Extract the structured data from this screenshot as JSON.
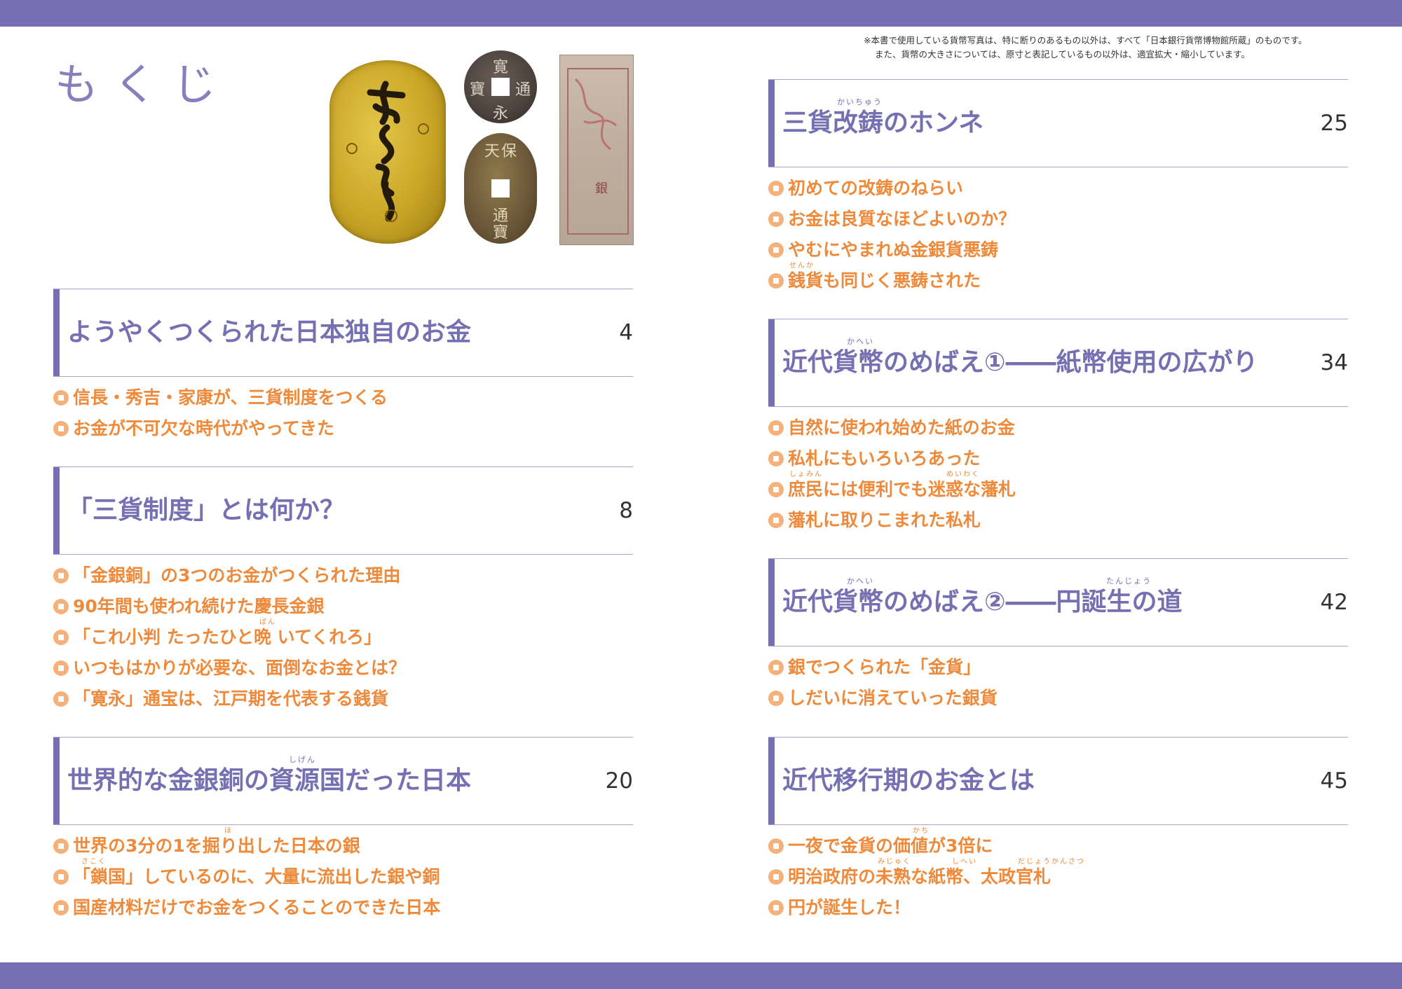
{
  "page_title": "もくじ",
  "note": {
    "line1": "※本書で使用している貨幣写真は、特に断りのあるもの以外は、すべて「日本銀行貨幣博物館所蔵」のものです。",
    "line2": "また、貨幣の大きさについては、原寸と表記しているもの以外は、適宜拡大・縮小しています。"
  },
  "images": {
    "coin1": {
      "icon": "koban-coin-image"
    },
    "coin2": {
      "icon": "kanei-tsuho-coin-image",
      "chars": [
        "寛",
        "通",
        "永",
        "寶"
      ]
    },
    "coin3": {
      "icon": "tenpo-tsuho-coin-image",
      "chars": [
        "天",
        "保",
        "通",
        "寶"
      ]
    },
    "note": {
      "icon": "hansatsu-paper-note-image",
      "mark": "銀"
    }
  },
  "colors": {
    "band": "#7670b3",
    "heading": "#7670b3",
    "item": "#ee8a3b",
    "bullet": "#f6b07a"
  },
  "sections": [
    {
      "title": "ようやくつくられた日本独自のお金",
      "page": "4",
      "items": [
        "信長・秀吉・家康が、三貨制度をつくる",
        "お金が不可欠な時代がやってきた"
      ]
    },
    {
      "title": "「三貨制度」とは何か？",
      "page": "8",
      "items": [
        "「金銀銅」の3つのお金がつくられた理由",
        "90年間も使われ続けた慶長金銀",
        "「これ小判 たったひと晩 いてくれろ」",
        "いつもはかりが必要な、面倒なお金とは？",
        "「寛永」通宝は、江戸期を代表する銭貨"
      ],
      "item_rubies": {
        "2": "ばん"
      }
    },
    {
      "title": "世界的な金銀銅の資源国だった日本",
      "page": "20",
      "ruby": "しげん",
      "items": [
        "世界の3分の1を掘り出した日本の銀",
        "「鎖国」しているのに、大量に流出した銀や銅",
        "国産材料だけでお金をつくることのできた日本"
      ],
      "item_rubies": {
        "0": "ほ",
        "1": "さこく"
      }
    },
    {
      "title": "三貨改鋳のホンネ",
      "page": "25",
      "ruby": "かいちゅう",
      "items": [
        "初めての改鋳のねらい",
        "お金は良質なほどよいのか？",
        "やむにやまれぬ金銀貨悪鋳",
        "銭貨も同じく悪鋳された"
      ],
      "item_rubies": {
        "3": "せんか"
      }
    },
    {
      "title": "近代貨幣のめばえ①――紙幣使用の広がり",
      "page": "34",
      "ruby": "かへい",
      "items": [
        "自然に使われ始めた紙のお金",
        "私札にもいろいろあった",
        "庶民には便利でも迷惑な藩札",
        "藩札に取りこまれた私札"
      ],
      "item_rubies": {
        "2": "しょみん",
        "2b": "めいわく"
      }
    },
    {
      "title": "近代貨幣のめばえ②――円誕生の道",
      "page": "42",
      "ruby": "かへい",
      "ruby2": "たんじょう",
      "items": [
        "銀でつくられた「金貨」",
        "しだいに消えていった銀貨"
      ]
    },
    {
      "title": "近代移行期のお金とは",
      "page": "45",
      "items": [
        "一夜で金貨の価値が3倍に",
        "明治政府の未熟な紙幣、太政官札",
        "円が誕生した！"
      ],
      "item_rubies": {
        "0": "かち",
        "1": "みじゅく",
        "1b": "しへい",
        "1c": "だじょうかんさつ"
      }
    }
  ]
}
